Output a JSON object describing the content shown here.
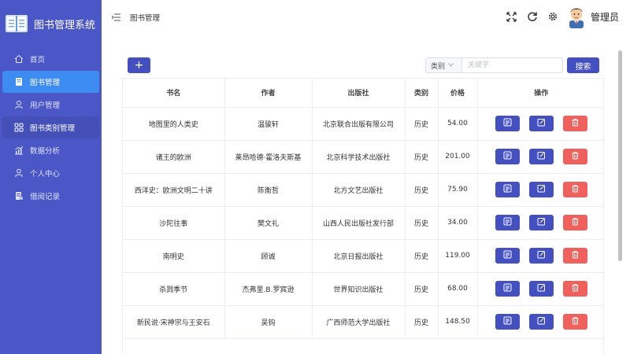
{
  "app": {
    "title": "图书管理系统"
  },
  "sidebar": {
    "items": [
      {
        "label": "首页",
        "icon": "home-icon"
      },
      {
        "label": "图书管理",
        "icon": "book-icon",
        "active": true
      },
      {
        "label": "用户管理",
        "icon": "user-icon"
      },
      {
        "label": "图书类别管理",
        "icon": "grid-icon"
      },
      {
        "label": "数据分析",
        "icon": "chart-icon"
      },
      {
        "label": "个人中心",
        "icon": "person-icon"
      },
      {
        "label": "借阅记录",
        "icon": "record-icon"
      }
    ]
  },
  "header": {
    "breadcrumb": "图书管理",
    "user_name": "管理员",
    "icons": [
      "fullscreen-icon",
      "refresh-icon",
      "settings-icon"
    ]
  },
  "toolbar": {
    "add_label": "+",
    "category_label": "类别",
    "keyword_placeholder": "关键字",
    "search_label": "搜索"
  },
  "table": {
    "columns": [
      "书名",
      "作者",
      "出版社",
      "类别",
      "价格",
      "操作"
    ],
    "rows": [
      {
        "title": "地图里的人类史",
        "author": "温骏轩",
        "publisher": "北京联合出版有限公司",
        "category": "历史",
        "price": "54.00"
      },
      {
        "title": "诸王的欧洲",
        "author": "莱昂哈德·霍洛夫斯基",
        "publisher": "北京科学技术出版社",
        "category": "历史",
        "price": "201.00"
      },
      {
        "title": "西洋史：欧洲文明二十讲",
        "author": "陈衡哲",
        "publisher": "北方文艺出版社",
        "category": "历史",
        "price": "75.90"
      },
      {
        "title": "沙陀往事",
        "author": "樊文礼",
        "publisher": "山西人民出版社发行部",
        "category": "历史",
        "price": "34.00"
      },
      {
        "title": "南明史",
        "author": "顾诚",
        "publisher": "北京日报出版社",
        "category": "历史",
        "price": "119.00"
      },
      {
        "title": "杀戮季节",
        "author": "杰弗里.B.罗宾逊",
        "publisher": "世界知识出版社",
        "category": "历史",
        "price": "68.00"
      },
      {
        "title": "新民说·宋神宗与王安石",
        "author": "吴钩",
        "publisher": "广西师范大学出版社",
        "category": "历史",
        "price": "148.50"
      }
    ]
  },
  "colors": {
    "sidebar_bg": "#4b57c6",
    "active_item": "#3d8cf2",
    "primary": "#4450c0",
    "danger": "#f0605c"
  }
}
